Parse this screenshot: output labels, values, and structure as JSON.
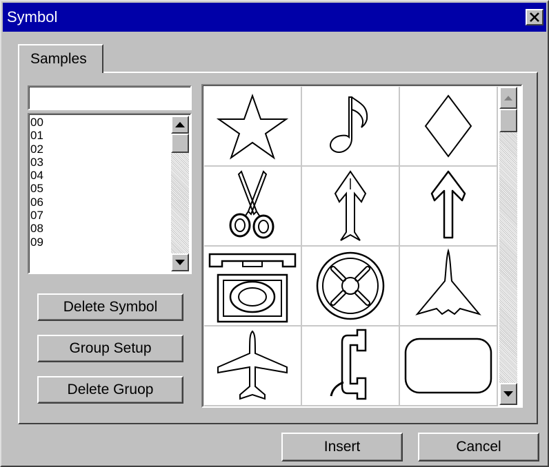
{
  "window": {
    "title": "Symbol"
  },
  "tabs": [
    {
      "label": "Samples"
    }
  ],
  "name_field": {
    "value": ""
  },
  "groups": {
    "items": [
      "00",
      "01",
      "02",
      "03",
      "04",
      "05",
      "06",
      "07",
      "08",
      "09"
    ]
  },
  "buttons": {
    "delete_symbol": "Delete Symbol",
    "group_setup": "Group Setup",
    "delete_group": "Delete Gruop",
    "insert": "Insert",
    "cancel": "Cancel"
  },
  "symbols": [
    "star-icon",
    "music-note-icon",
    "diamond-icon",
    "scissors-icon",
    "feathered-arrow-icon",
    "up-arrow-icon",
    "telephone-icon",
    "wheel-icon",
    "jet-icon",
    "airplane-icon",
    "handset-icon",
    "rounded-rectangle-icon"
  ]
}
